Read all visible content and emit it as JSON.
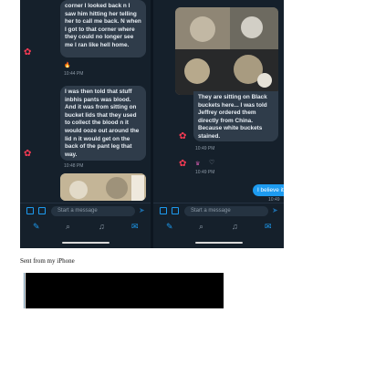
{
  "left_pane": {
    "messages": [
      {
        "text": "corner I looked back n I saw him hitting her telling her to call me back. N when I got to that corner where they could no longer see me I ran like hell home."
      },
      {
        "text": "I was then told that stuff inbhis pants was blood. And it was from sitting on bucket lids that they used to collect the blood n it would ooze out around the lid n it would get on the back of the pant leg that way."
      }
    ],
    "timestamps": [
      "10:44 PM",
      "10:48 PM"
    ],
    "reaction": "🔥"
  },
  "right_pane": {
    "image_caption": "They are sitting on Black buckets here... I was told Jeffrey ordered them directly from China. Because white buckets stained.",
    "timestamps": [
      "10:49 PM",
      "10:49 PM",
      "10:49 PM ✓"
    ],
    "sent_message": "I believe it all"
  },
  "composer": {
    "placeholder": "Start a message"
  },
  "caption": "Sent from my iPhone",
  "colors": {
    "background": "#15202b",
    "bubble": "#2f3c4a",
    "accent": "#1d9bf0",
    "redaction": "#000000"
  },
  "icons": [
    "image-icon",
    "gif-icon",
    "send-icon",
    "compose-icon",
    "search-icon",
    "bell-icon",
    "mail-icon",
    "heart-icon"
  ]
}
